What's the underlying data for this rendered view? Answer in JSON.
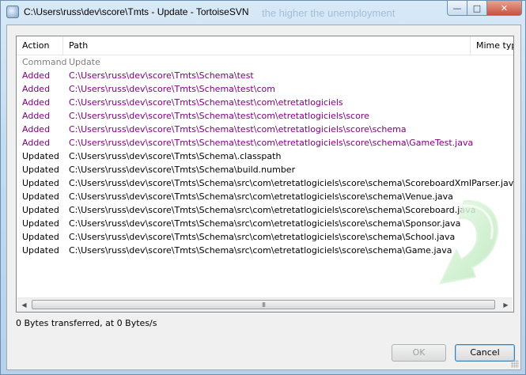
{
  "window": {
    "title": "C:\\Users\\russ\\dev\\score\\Tmts - Update - TortoiseSVN",
    "background_title": "the higher the unemployment",
    "controls": {
      "minimize": "—",
      "maximize": "□",
      "close": "✕"
    }
  },
  "table": {
    "columns": [
      "Action",
      "Path",
      "Mime type"
    ],
    "rows": [
      {
        "action": "Command",
        "path": "Update",
        "kind": "command"
      },
      {
        "action": "Added",
        "path": "C:\\Users\\russ\\dev\\score\\Tmts\\Schema\\test",
        "kind": "added"
      },
      {
        "action": "Added",
        "path": "C:\\Users\\russ\\dev\\score\\Tmts\\Schema\\test\\com",
        "kind": "added"
      },
      {
        "action": "Added",
        "path": "C:\\Users\\russ\\dev\\score\\Tmts\\Schema\\test\\com\\etretatlogiciels",
        "kind": "added"
      },
      {
        "action": "Added",
        "path": "C:\\Users\\russ\\dev\\score\\Tmts\\Schema\\test\\com\\etretatlogiciels\\score",
        "kind": "added"
      },
      {
        "action": "Added",
        "path": "C:\\Users\\russ\\dev\\score\\Tmts\\Schema\\test\\com\\etretatlogiciels\\score\\schema",
        "kind": "added"
      },
      {
        "action": "Added",
        "path": "C:\\Users\\russ\\dev\\score\\Tmts\\Schema\\test\\com\\etretatlogiciels\\score\\schema\\GameTest.java",
        "kind": "added"
      },
      {
        "action": "Updated",
        "path": "C:\\Users\\russ\\dev\\score\\Tmts\\Schema\\.classpath",
        "kind": "updated"
      },
      {
        "action": "Updated",
        "path": "C:\\Users\\russ\\dev\\score\\Tmts\\Schema\\build.number",
        "kind": "updated"
      },
      {
        "action": "Updated",
        "path": "C:\\Users\\russ\\dev\\score\\Tmts\\Schema\\src\\com\\etretatlogiciels\\score\\schema\\ScoreboardXmlParser.java",
        "kind": "updated"
      },
      {
        "action": "Updated",
        "path": "C:\\Users\\russ\\dev\\score\\Tmts\\Schema\\src\\com\\etretatlogiciels\\score\\schema\\Venue.java",
        "kind": "updated"
      },
      {
        "action": "Updated",
        "path": "C:\\Users\\russ\\dev\\score\\Tmts\\Schema\\src\\com\\etretatlogiciels\\score\\schema\\Scoreboard.java",
        "kind": "updated"
      },
      {
        "action": "Updated",
        "path": "C:\\Users\\russ\\dev\\score\\Tmts\\Schema\\src\\com\\etretatlogiciels\\score\\schema\\Sponsor.java",
        "kind": "updated"
      },
      {
        "action": "Updated",
        "path": "C:\\Users\\russ\\dev\\score\\Tmts\\Schema\\src\\com\\etretatlogiciels\\score\\schema\\School.java",
        "kind": "updated"
      },
      {
        "action": "Updated",
        "path": "C:\\Users\\russ\\dev\\score\\Tmts\\Schema\\src\\com\\etretatlogiciels\\score\\schema\\Game.java",
        "kind": "updated"
      }
    ]
  },
  "scrollbar": {
    "thumb_grip": "III"
  },
  "status": {
    "text": "0 Bytes transferred, at 0 Bytes/s"
  },
  "buttons": {
    "ok": "OK",
    "cancel": "Cancel"
  },
  "colors": {
    "added": "#800080",
    "command": "#808080",
    "updated": "#000000",
    "watermark_arrow": "#c9f0c9"
  },
  "icons": {
    "app": "tortoisesvn-icon",
    "watermark": "update-arrow-icon"
  }
}
